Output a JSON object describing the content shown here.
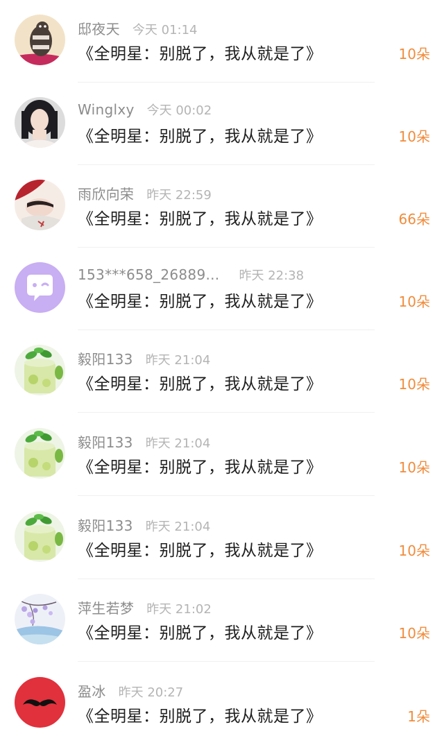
{
  "colors": {
    "name": "#8c8c8c",
    "time": "#b4b4b4",
    "gift_text": "#1e1e1e",
    "count": "#f08c3c",
    "separator": "#f0f0f0"
  },
  "records": [
    {
      "user": "邸夜天",
      "time": "今天 01:14",
      "gift": "《全明星：别脱了，我从就是了》",
      "count": "10朵",
      "avatar_icon": "hamster-avatar"
    },
    {
      "user": "Winglxy",
      "time": "今天 00:02",
      "gift": "《全明星：别脱了，我从就是了》",
      "count": "10朵",
      "avatar_icon": "woman-portrait-avatar"
    },
    {
      "user": "雨欣向荣",
      "time": "昨天 22:59",
      "gift": "《全明星：别脱了，我从就是了》",
      "count": "66朵",
      "avatar_icon": "illustration-avatar"
    },
    {
      "user": "153***658_26889...",
      "time": "昨天 22:38",
      "gift": "《全明星：别脱了，我从就是了》",
      "count": "10朵",
      "avatar_icon": "chat-bubble-avatar"
    },
    {
      "user": "毅阳133",
      "time": "昨天 21:04",
      "gift": "《全明星：别脱了，我从就是了》",
      "count": "10朵",
      "avatar_icon": "drink-avatar"
    },
    {
      "user": "毅阳133",
      "time": "昨天 21:04",
      "gift": "《全明星：别脱了，我从就是了》",
      "count": "10朵",
      "avatar_icon": "drink-avatar"
    },
    {
      "user": "毅阳133",
      "time": "昨天 21:04",
      "gift": "《全明星：别脱了，我从就是了》",
      "count": "10朵",
      "avatar_icon": "drink-avatar"
    },
    {
      "user": "萍生若梦",
      "time": "昨天 21:02",
      "gift": "《全明星：别脱了，我从就是了》",
      "count": "10朵",
      "avatar_icon": "flower-avatar"
    },
    {
      "user": "盈冰",
      "time": "昨天 20:27",
      "gift": "《全明星：别脱了，我从就是了》",
      "count": "1朵",
      "avatar_icon": "mustache-avatar"
    }
  ]
}
